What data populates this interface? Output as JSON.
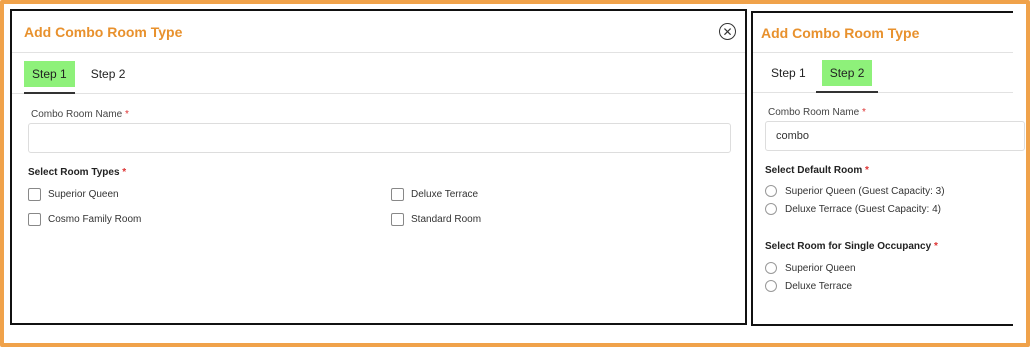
{
  "step1": {
    "title": "Add Combo Room Type",
    "tabs": [
      "Step 1",
      "Step 2"
    ],
    "name_label": "Combo Room Name",
    "required_mark": "*",
    "name_value": "",
    "room_types_label": "Select Room Types",
    "room_types": [
      "Superior Queen",
      "Deluxe Terrace",
      "Cosmo Family Room",
      "Standard Room"
    ]
  },
  "step2": {
    "title": "Add Combo Room Type",
    "tabs": [
      "Step 1",
      "Step 2"
    ],
    "name_label": "Combo Room Name",
    "name_value": "combo",
    "default_room_label": "Select Default Room",
    "default_rooms": [
      "Superior Queen (Guest Capacity: 3)",
      "Deluxe Terrace (Guest Capacity: 4)"
    ],
    "single_occupancy_label": "Select Room for Single Occupancy",
    "single_rooms": [
      "Superior Queen",
      "Deluxe Terrace"
    ]
  },
  "icons": {
    "close": "close-circle-icon"
  },
  "colors": {
    "accent": "#e8912d",
    "active_tab": "#8ef17a",
    "frame": "#f0a24a",
    "required": "#dd3333"
  }
}
